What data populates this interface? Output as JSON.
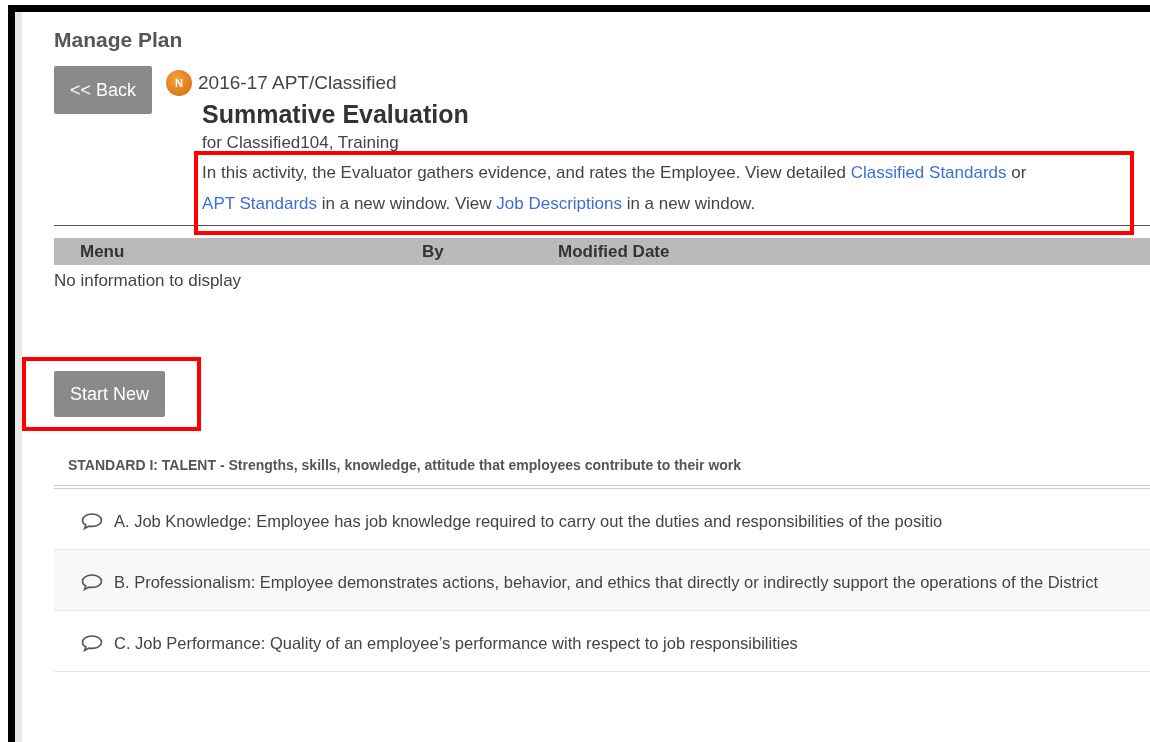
{
  "page_title": "Manage Plan",
  "back_button": "<< Back",
  "badge": "N",
  "plan": "2016-17 APT/Classified",
  "heading": "Summative Evaluation",
  "subtitle": "for Classified104, Training",
  "description": {
    "highlighted": true,
    "parts": [
      {
        "kind": "text",
        "text": "In this activity, the Evaluator gathers evidence, and rates the Employee. View detailed "
      },
      {
        "kind": "link",
        "text": "Classified Standards"
      },
      {
        "kind": "text",
        "text": " or "
      },
      {
        "kind": "link",
        "text": "APT Standards"
      },
      {
        "kind": "text",
        "text": " in a new window. View "
      },
      {
        "kind": "link",
        "text": "Job Descriptions"
      },
      {
        "kind": "text",
        "text": " in a new window."
      }
    ]
  },
  "table": {
    "columns": [
      "Menu",
      "By",
      "Modified Date"
    ],
    "empty_message": "No information to display"
  },
  "start_button": {
    "label": "Start New",
    "highlighted": true
  },
  "standard": {
    "title": "STANDARD I: TALENT - Strengths, skills, knowledge, attitude that employees contribute to their work",
    "items": [
      {
        "text": "A. Job Knowledge: Employee has job knowledge required to carry out the duties and responsibilities of the positio"
      },
      {
        "text": "B. Professionalism: Employee demonstrates actions, behavior, and ethics that directly or indirectly support the operations of the District"
      },
      {
        "text": "C. Job Performance: Quality of an employee’s performance with respect to job responsibilities"
      }
    ]
  }
}
